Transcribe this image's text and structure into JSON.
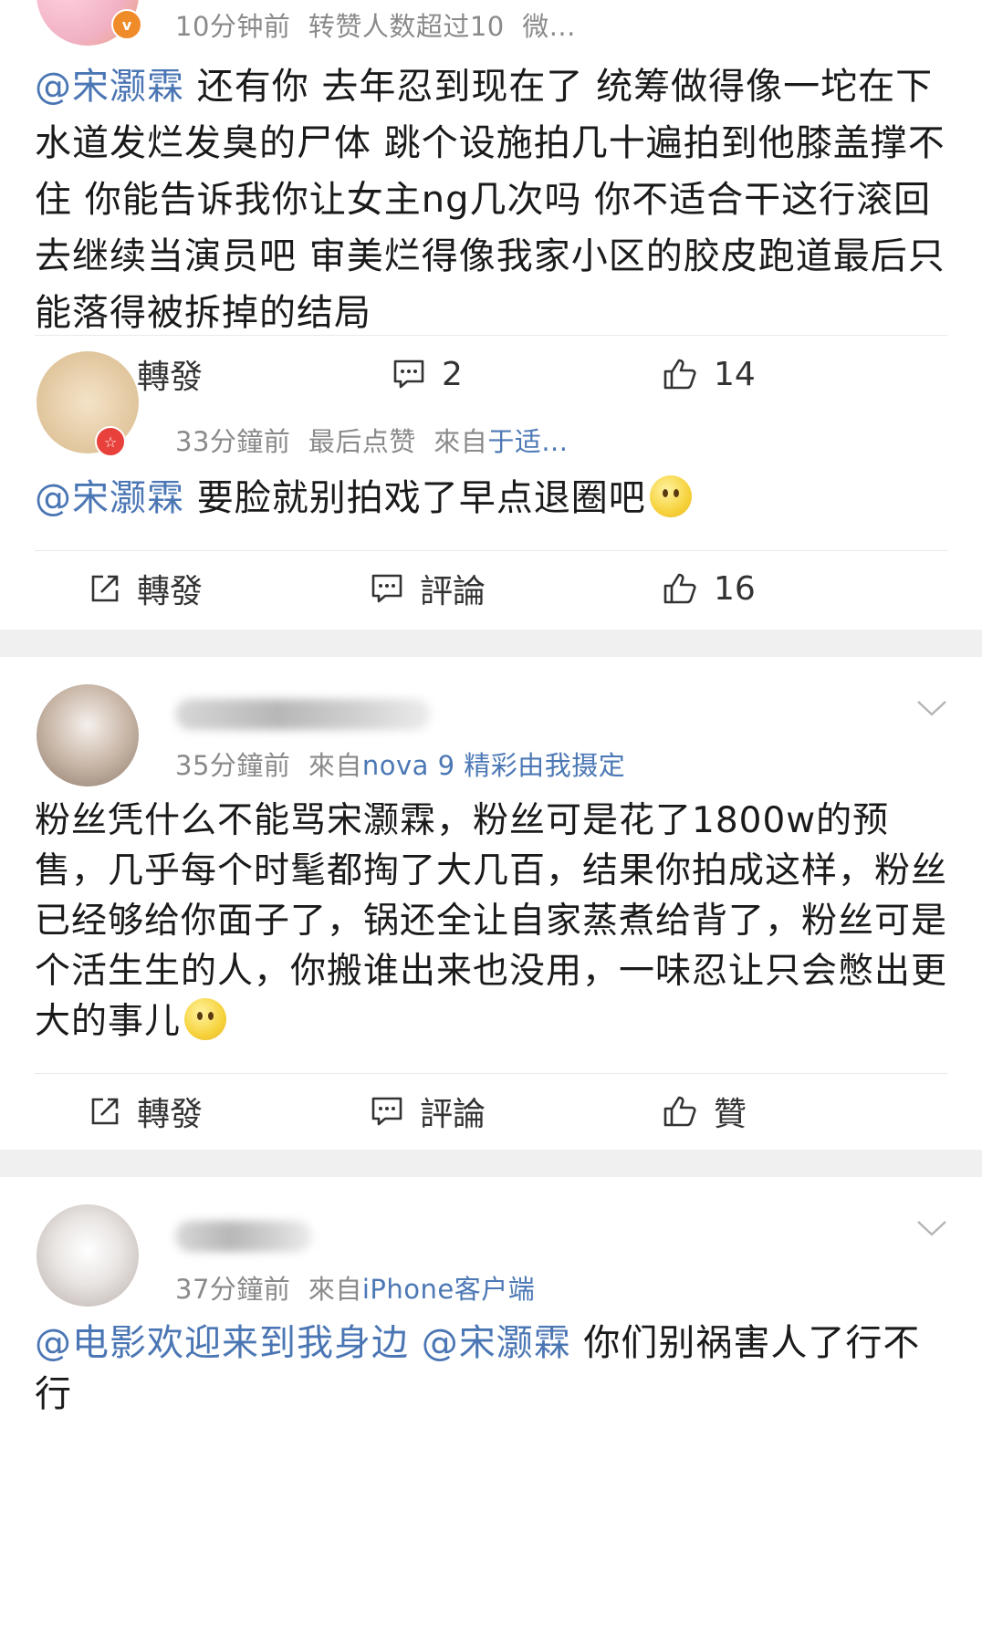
{
  "comments": [
    {
      "meta": {
        "time": "10分钟前",
        "extra": "转赞人数超过10",
        "source_prefix": "",
        "source": "微..."
      },
      "mention": "@宋灏霖",
      "text": " 还有你 去年忍到现在了 统筹做得像一坨在下水道发烂发臭的尸体 跳个设施拍几十遍拍到他膝盖撑不住 你能告诉我你让女主ng几次吗 你不适合干这行滚回去继续当演员吧 审美烂得像我家小区的胶皮跑道最后只能落得被拆掉的结局",
      "repost": "轉發",
      "comment": "2",
      "like": "14"
    },
    {
      "meta": {
        "time": "33分鐘前",
        "extra": "最后点赞",
        "source_prefix": "來自",
        "source": "于适..."
      },
      "mention": "@宋灏霖",
      "text": " 要脸就别拍戏了早点退圈吧",
      "repost": "轉發",
      "comment": "評論",
      "like": "16"
    },
    {
      "meta": {
        "time": "35分鐘前",
        "extra": "",
        "source_prefix": "來自",
        "source": "nova 9 精彩由我摄定"
      },
      "mention": "",
      "text": "粉丝凭什么不能骂宋灏霖，粉丝可是花了1800w的预售，几乎每个时髦都掏了大几百，结果你拍成这样，粉丝已经够给你面子了，锅还全让自家蒸煮给背了，粉丝可是个活生生的人，你搬谁出来也没用，一味忍让只会憋出更大的事儿",
      "repost": "轉發",
      "comment": "評論",
      "like": "贊"
    },
    {
      "meta": {
        "time": "37分鐘前",
        "extra": "",
        "source_prefix": "來自",
        "source": "iPhone客户端"
      },
      "mention": "@电影欢迎来到我身边 @宋灏霖",
      "text": " 你们别祸害人了行不行"
    }
  ],
  "icons": {
    "repost": "repost-icon",
    "comment": "comment-icon",
    "like": "thumb-up-icon",
    "more": "chevron-down-icon"
  },
  "colors": {
    "link": "#4b76b4",
    "meta": "#8a8a8a",
    "separator": "#f0f0f0"
  }
}
